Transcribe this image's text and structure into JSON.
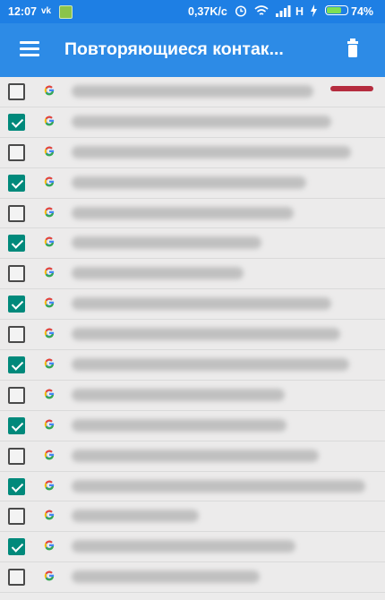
{
  "status_bar": {
    "time": "12:07",
    "vk": "vk",
    "speed": "0,37K/c",
    "network": "H",
    "battery_percent": "74%",
    "battery_level": 0.74
  },
  "app_bar": {
    "title": "Повторяющиеся контак..."
  },
  "contacts": [
    {
      "checked": false
    },
    {
      "checked": true
    },
    {
      "checked": false
    },
    {
      "checked": true
    },
    {
      "checked": false
    },
    {
      "checked": true
    },
    {
      "checked": false
    },
    {
      "checked": true
    },
    {
      "checked": false
    },
    {
      "checked": true
    },
    {
      "checked": false
    },
    {
      "checked": true
    },
    {
      "checked": false
    },
    {
      "checked": true
    },
    {
      "checked": false
    },
    {
      "checked": true
    },
    {
      "checked": false
    }
  ],
  "colors": {
    "status_bar": "#1e7fe4",
    "app_bar": "#2d8be6",
    "checkbox_checked": "#00897b",
    "background": "#ecebeb"
  }
}
